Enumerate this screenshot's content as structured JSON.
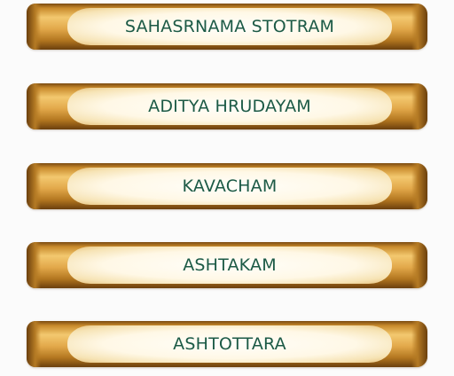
{
  "menu": {
    "items": [
      {
        "label": "SAHASRNAMA STOTRAM"
      },
      {
        "label": "ADITYA HRUDAYAM"
      },
      {
        "label": "KAVACHAM"
      },
      {
        "label": "ASHTAKAM"
      },
      {
        "label": "ASHTOTTARA"
      }
    ]
  },
  "colors": {
    "background": "#fbfbfb",
    "label_text": "#1c5a46",
    "scroll_gold": "#e2a84a",
    "scroll_dark": "#6b3f0d",
    "parchment": "#fff8e6"
  }
}
